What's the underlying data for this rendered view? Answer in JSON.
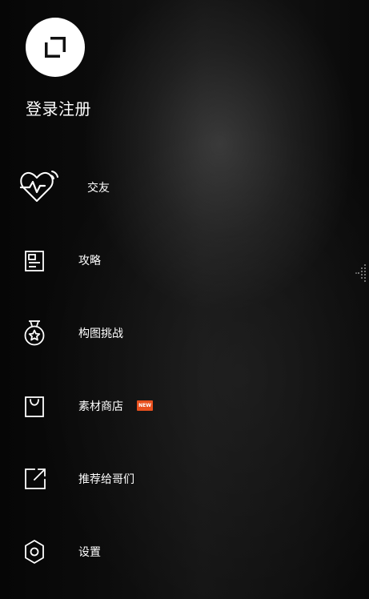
{
  "profile": {
    "avatar_icon": "square-logo-icon",
    "login_label": "登录注册"
  },
  "menu": [
    {
      "label": "交友",
      "icon": "heart-pulse-icon"
    },
    {
      "label": "攻略",
      "icon": "article-icon"
    },
    {
      "label": "构图挑战",
      "icon": "medal-star-icon"
    },
    {
      "label": "素材商店",
      "icon": "shopping-bag-icon",
      "badge": "NEW"
    },
    {
      "label": "推荐给哥们",
      "icon": "share-external-icon"
    },
    {
      "label": "设置",
      "icon": "settings-hexagon-icon"
    }
  ],
  "colors": {
    "background": "#0c0c0c",
    "avatar_bg": "#ffffff",
    "text": "#ffffff",
    "badge": "#e8501e"
  }
}
